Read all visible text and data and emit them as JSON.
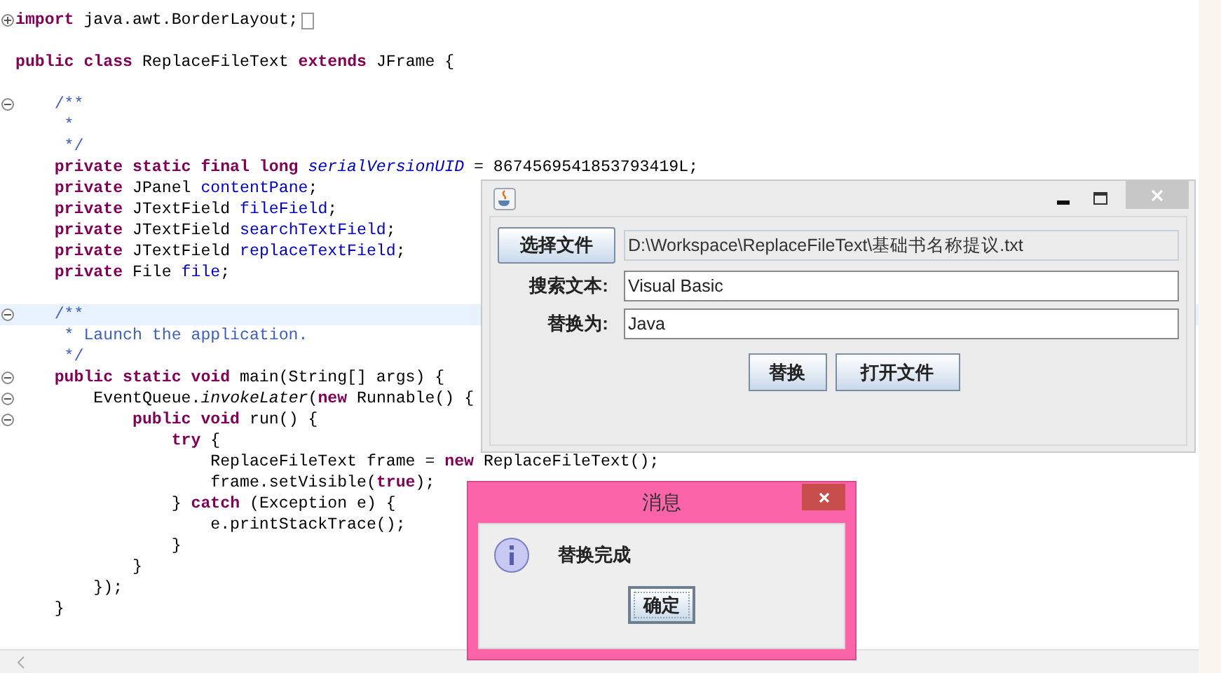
{
  "editor": {
    "lines": [
      {
        "kind": "code",
        "collapsed": true,
        "folded_marker": true,
        "tokens": [
          {
            "kind": "kw",
            "text": "import"
          },
          {
            "kind": "text",
            "text": " java.awt.BorderLayout;"
          }
        ]
      },
      {
        "kind": "blank"
      },
      {
        "kind": "code",
        "tokens": [
          {
            "kind": "kw",
            "text": "public class"
          },
          {
            "kind": "text",
            "text": " ReplaceFileText "
          },
          {
            "kind": "kw",
            "text": "extends"
          },
          {
            "kind": "text",
            "text": " JFrame {"
          }
        ]
      },
      {
        "kind": "blank"
      },
      {
        "kind": "code",
        "collapsed": false,
        "tokens": [
          {
            "kind": "comment",
            "text": "    /**"
          }
        ]
      },
      {
        "kind": "code",
        "tokens": [
          {
            "kind": "comment",
            "text": "     *"
          }
        ]
      },
      {
        "kind": "code",
        "tokens": [
          {
            "kind": "comment",
            "text": "     */"
          }
        ]
      },
      {
        "kind": "code",
        "tokens": [
          {
            "kind": "kw",
            "text": "    private static final long"
          },
          {
            "kind": "static_field",
            "text": " serialVersionUID"
          },
          {
            "kind": "text",
            "text": " = 8674569541853793419L;"
          }
        ]
      },
      {
        "kind": "code",
        "tokens": [
          {
            "kind": "kw",
            "text": "    private"
          },
          {
            "kind": "text",
            "text": " JPanel "
          },
          {
            "kind": "field",
            "text": "contentPane"
          },
          {
            "kind": "text",
            "text": ";"
          }
        ]
      },
      {
        "kind": "code",
        "tokens": [
          {
            "kind": "kw",
            "text": "    private"
          },
          {
            "kind": "text",
            "text": " JTextField "
          },
          {
            "kind": "field",
            "text": "fileField"
          },
          {
            "kind": "text",
            "text": ";"
          }
        ]
      },
      {
        "kind": "code",
        "tokens": [
          {
            "kind": "kw",
            "text": "    private"
          },
          {
            "kind": "text",
            "text": " JTextField "
          },
          {
            "kind": "field",
            "text": "searchTextField"
          },
          {
            "kind": "text",
            "text": ";"
          }
        ]
      },
      {
        "kind": "code",
        "tokens": [
          {
            "kind": "kw",
            "text": "    private"
          },
          {
            "kind": "text",
            "text": " JTextField "
          },
          {
            "kind": "field",
            "text": "replaceTextField"
          },
          {
            "kind": "text",
            "text": ";"
          }
        ]
      },
      {
        "kind": "code",
        "tokens": [
          {
            "kind": "kw",
            "text": "    private"
          },
          {
            "kind": "text",
            "text": " File "
          },
          {
            "kind": "field",
            "text": "file"
          },
          {
            "kind": "text",
            "text": ";"
          }
        ]
      },
      {
        "kind": "blank"
      },
      {
        "kind": "code",
        "collapsed": false,
        "highlighted": true,
        "tokens": [
          {
            "kind": "comment",
            "text": "    /**"
          }
        ]
      },
      {
        "kind": "code",
        "tokens": [
          {
            "kind": "comment",
            "text": "     * Launch the application."
          }
        ]
      },
      {
        "kind": "code",
        "tokens": [
          {
            "kind": "comment",
            "text": "     */"
          }
        ]
      },
      {
        "kind": "code",
        "collapsed": false,
        "tokens": [
          {
            "kind": "kw",
            "text": "    public static void"
          },
          {
            "kind": "text",
            "text": " main(String[] args) {"
          }
        ]
      },
      {
        "kind": "code",
        "collapsed": false,
        "tokens": [
          {
            "kind": "text",
            "text": "        EventQueue."
          },
          {
            "kind": "static_method",
            "text": "invokeLater"
          },
          {
            "kind": "text",
            "text": "("
          },
          {
            "kind": "kw",
            "text": "new"
          },
          {
            "kind": "text",
            "text": " Runnable() {"
          }
        ]
      },
      {
        "kind": "code",
        "collapsed": false,
        "tokens": [
          {
            "kind": "kw",
            "text": "            public void"
          },
          {
            "kind": "text",
            "text": " run() {"
          }
        ]
      },
      {
        "kind": "code",
        "tokens": [
          {
            "kind": "kw",
            "text": "                try"
          },
          {
            "kind": "text",
            "text": " {"
          }
        ]
      },
      {
        "kind": "code",
        "tokens": [
          {
            "kind": "text",
            "text": "                    ReplaceFileText frame = "
          },
          {
            "kind": "kw",
            "text": "new"
          },
          {
            "kind": "text",
            "text": " ReplaceFileText();"
          }
        ]
      },
      {
        "kind": "code",
        "tokens": [
          {
            "kind": "text",
            "text": "                    frame.setVisible("
          },
          {
            "kind": "kw",
            "text": "true"
          },
          {
            "kind": "text",
            "text": ");"
          }
        ]
      },
      {
        "kind": "code",
        "tokens": [
          {
            "kind": "text",
            "text": "                } "
          },
          {
            "kind": "kw",
            "text": "catch"
          },
          {
            "kind": "text",
            "text": " (Exception e) {"
          }
        ]
      },
      {
        "kind": "code",
        "tokens": [
          {
            "kind": "text",
            "text": "                    e.printStackTrace();"
          }
        ]
      },
      {
        "kind": "code",
        "tokens": [
          {
            "kind": "text",
            "text": "                }"
          }
        ]
      },
      {
        "kind": "code",
        "tokens": [
          {
            "kind": "text",
            "text": "            }"
          }
        ]
      },
      {
        "kind": "code",
        "tokens": [
          {
            "kind": "text",
            "text": "        });"
          }
        ]
      },
      {
        "kind": "code",
        "tokens": [
          {
            "kind": "text",
            "text": "    }"
          }
        ]
      }
    ]
  },
  "window": {
    "choose_button": "选择文件",
    "file_field": {
      "value": "D:\\Workspace\\ReplaceFileText\\基础书名称提议.txt",
      "disabled": true
    },
    "search": {
      "label": "搜索文本:",
      "value": "Visual Basic"
    },
    "replace": {
      "label": "替换为:",
      "value": "Java"
    },
    "actions": [
      {
        "label": "替换"
      },
      {
        "label": "打开文件"
      }
    ]
  },
  "dialog": {
    "title": "消息",
    "message": "替换完成",
    "button": {
      "label": "确定",
      "focused": true
    }
  }
}
